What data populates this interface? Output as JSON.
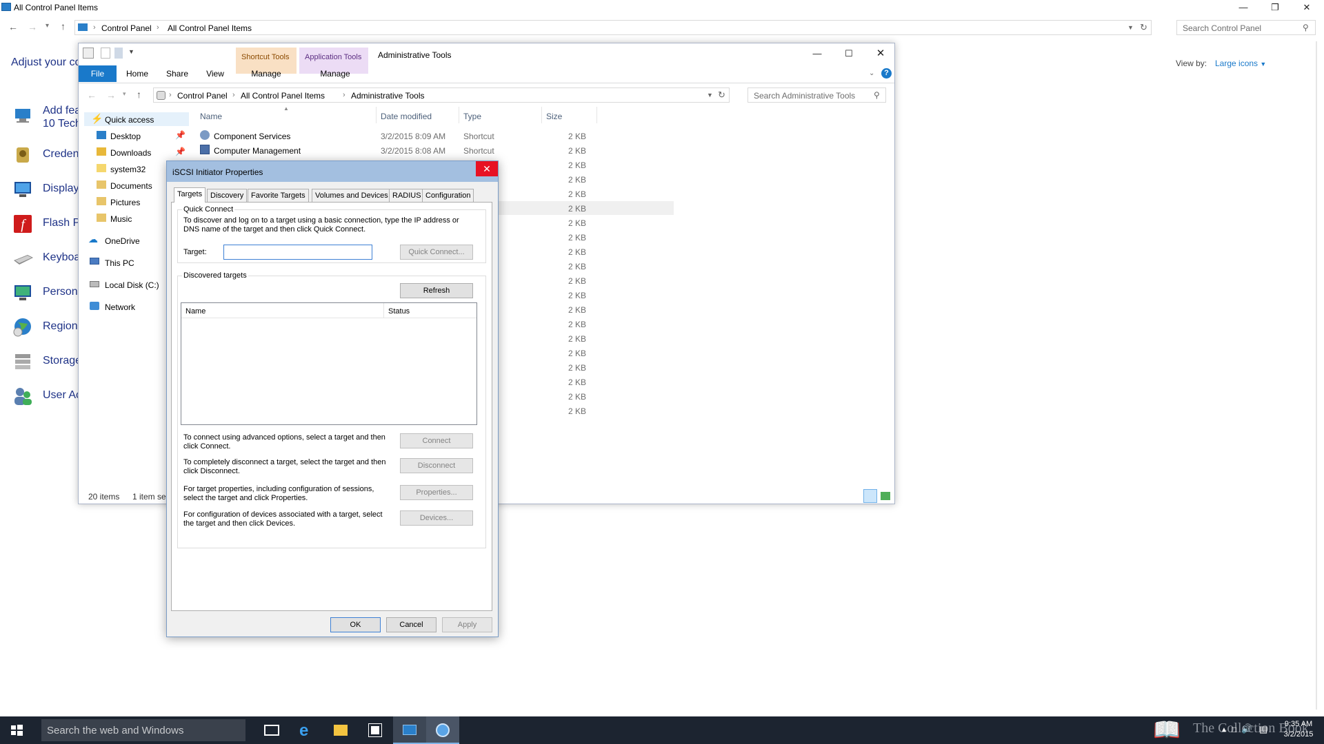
{
  "control_panel": {
    "title": "All Control Panel Items",
    "breadcrumb": [
      "Control Panel",
      "All Control Panel Items"
    ],
    "search_placeholder": "Search Control Panel",
    "heading": "Adjust your co",
    "view_by_label": "View by:",
    "view_by_value": "Large icons",
    "items": [
      {
        "label": "Add fea\n10 Tech",
        "icon": "add-features-icon"
      },
      {
        "label": "Creden",
        "icon": "credential-manager-icon"
      },
      {
        "label": "Display",
        "icon": "display-icon"
      },
      {
        "label": "Flash Pl",
        "icon": "flash-player-icon"
      },
      {
        "label": "Keyboa",
        "icon": "keyboard-icon"
      },
      {
        "label": "Persona",
        "icon": "personalization-icon"
      },
      {
        "label": "Region",
        "icon": "region-icon"
      },
      {
        "label": "Storage",
        "icon": "storage-spaces-icon"
      },
      {
        "label": "User Ac",
        "icon": "user-accounts-icon"
      }
    ]
  },
  "admin_tools": {
    "title": "Administrative Tools",
    "context_tabs": [
      "Shortcut Tools",
      "Application Tools"
    ],
    "ribbon_tabs": [
      "File",
      "Home",
      "Share",
      "View",
      "Manage",
      "Manage"
    ],
    "breadcrumb": [
      "Control Panel",
      "All Control Panel Items",
      "Administrative Tools"
    ],
    "search_placeholder": "Search Administrative Tools",
    "nav": [
      {
        "label": "Quick access",
        "icon": "star-icon"
      },
      {
        "label": "Desktop",
        "icon": "desktop-folder-icon"
      },
      {
        "label": "Downloads",
        "icon": "downloads-folder-icon"
      },
      {
        "label": "system32",
        "icon": "folder-icon"
      },
      {
        "label": "Documents",
        "icon": "documents-folder-icon"
      },
      {
        "label": "Pictures",
        "icon": "pictures-folder-icon"
      },
      {
        "label": "Music",
        "icon": "music-folder-icon"
      },
      {
        "label": "OneDrive",
        "icon": "cloud-icon"
      },
      {
        "label": "This PC",
        "icon": "computer-icon"
      },
      {
        "label": "Local Disk (C:)",
        "icon": "disk-icon"
      },
      {
        "label": "Network",
        "icon": "network-icon"
      }
    ],
    "columns": [
      "Name",
      "Date modified",
      "Type",
      "Size"
    ],
    "rows": [
      {
        "name": "Component Services",
        "date": "3/2/2015 8:09 AM",
        "type": "Shortcut",
        "size": "2 KB"
      },
      {
        "name": "Computer Management",
        "date": "3/2/2015 8:08 AM",
        "type": "Shortcut",
        "size": "2 KB"
      }
    ],
    "more_sizes": [
      "2 KB",
      "2 KB",
      "2 KB",
      "2 KB",
      "2 KB",
      "2 KB",
      "2 KB",
      "2 KB",
      "2 KB",
      "2 KB",
      "2 KB",
      "2 KB",
      "2 KB",
      "2 KB",
      "2 KB",
      "2 KB",
      "2 KB",
      "2 KB"
    ],
    "status_items": "20 items",
    "status_selected": "1 item se"
  },
  "dialog": {
    "title": "iSCSI Initiator Properties",
    "tabs": [
      "Targets",
      "Discovery",
      "Favorite Targets",
      "Volumes and Devices",
      "RADIUS",
      "Configuration"
    ],
    "quick_connect_group": "Quick Connect",
    "quick_connect_text": "To discover and log on to a target using a basic connection, type the IP address or DNS name of the target and then click Quick Connect.",
    "target_label": "Target:",
    "target_value": "",
    "quick_connect_button": "Quick Connect...",
    "discovered_group": "Discovered targets",
    "refresh_button": "Refresh",
    "list_columns": [
      "Name",
      "Status"
    ],
    "actions": [
      {
        "text": "To connect using advanced options, select a target and then click Connect.",
        "button": "Connect"
      },
      {
        "text": "To completely disconnect a target, select the target and then click Disconnect.",
        "button": "Disconnect"
      },
      {
        "text": "For target properties, including configuration of sessions, select the target and click Properties.",
        "button": "Properties..."
      },
      {
        "text": "For configuration of devices associated with a target, select the target and then click Devices.",
        "button": "Devices..."
      }
    ],
    "ok_button": "OK",
    "cancel_button": "Cancel",
    "apply_button": "Apply"
  },
  "taskbar": {
    "search_placeholder": "Search the web and Windows",
    "watermark": "The Collection Book",
    "time": "9:35 AM",
    "date": "3/2/2015"
  },
  "colors": {
    "accent": "#1979ca",
    "taskbar": "#1c2430",
    "dialog_title": "#a3bfe0",
    "close_red": "#e81123"
  }
}
